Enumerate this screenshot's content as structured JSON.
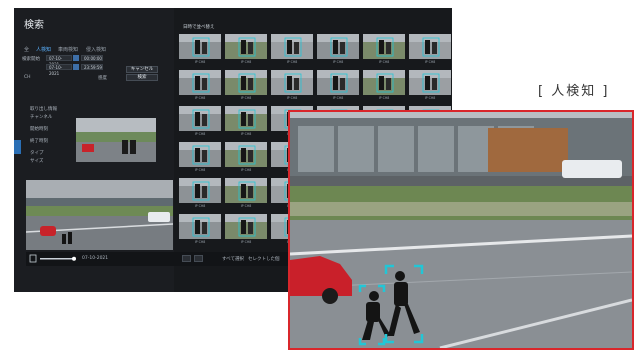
{
  "monitor": {
    "title": "検索",
    "tabs": [
      "全",
      "人検知",
      "車両検知",
      "侵入検知"
    ],
    "active_tab": 1,
    "form": {
      "start_label": "検索開始",
      "start_date": "07-10-2021",
      "start_time": "00:00:00",
      "end_date": "07-10-2021",
      "end_time": "23:59:59",
      "channel_label": "CH",
      "cancel_button": "キャンセル",
      "sensitivity_label": "感度",
      "search_button": "検索"
    },
    "detail": {
      "section_title": "取り出し情報",
      "channel": "チャンネル",
      "start": "開始時刻",
      "end": "終了時刻",
      "type": "タイプ",
      "size": "サイズ"
    },
    "grid": {
      "header": "日時で並べ替え",
      "caption": "IP CH8"
    },
    "playbar": {
      "time": "07-10-2021",
      "select_all": "すべて選択",
      "selected_backup": "セレクトした個"
    }
  },
  "zoom": {
    "label": "[ 人検知 ]"
  },
  "colors": {
    "highlight_red": "#d9262b",
    "detect_box": "#22c6d6",
    "active_blue": "#2a6fb5"
  }
}
